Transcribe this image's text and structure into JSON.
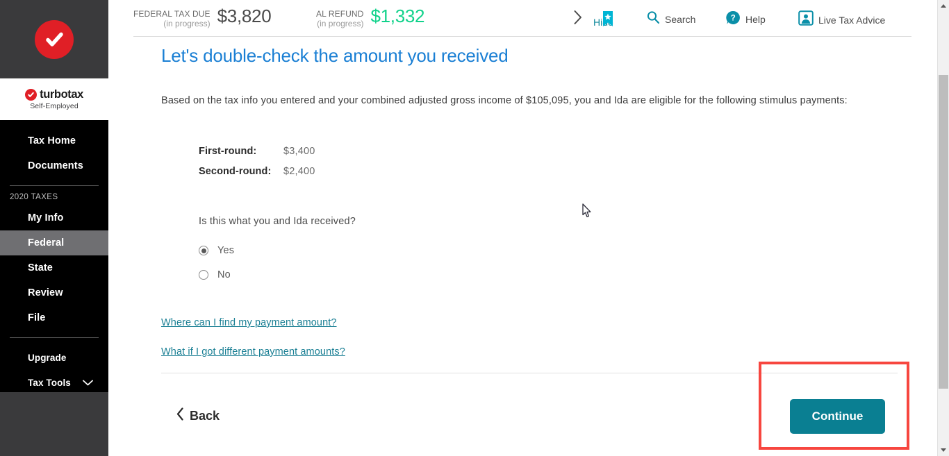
{
  "sidebar": {
    "logo": {
      "brand": "turbotax",
      "edition": "Self-Employed",
      "mark_icon": "red-check-circle-icon"
    },
    "primary_items": [
      {
        "label": "Tax Home",
        "name": "tax-home"
      },
      {
        "label": "Documents",
        "name": "documents"
      }
    ],
    "section_label": "2020 TAXES",
    "tax_items": [
      {
        "label": "My Info",
        "name": "my-info",
        "active": false
      },
      {
        "label": "Federal",
        "name": "federal",
        "active": true
      },
      {
        "label": "State",
        "name": "state",
        "active": false
      },
      {
        "label": "Review",
        "name": "review",
        "active": false
      },
      {
        "label": "File",
        "name": "file",
        "active": false
      }
    ],
    "footer_items": [
      {
        "label": "Upgrade",
        "name": "upgrade",
        "chevron": false
      },
      {
        "label": "Tax Tools",
        "name": "tax-tools",
        "chevron": true
      }
    ]
  },
  "header": {
    "federal": {
      "caption": "FEDERAL TAX DUE",
      "status": "(in progress)",
      "amount": "$3,820",
      "color": "#4a4a4a"
    },
    "state": {
      "caption": "AL REFUND",
      "status": "(in progress)",
      "amount": "$1,332",
      "color": "#11d28b"
    },
    "expand_icon": "chevron-right-icon",
    "hide_label": "Hide",
    "bookmark_icon": "bookmark-star-icon",
    "tools": [
      {
        "label": "Search",
        "icon": "search-icon",
        "name": "search"
      },
      {
        "label": "Help",
        "icon": "help-question-icon",
        "name": "help"
      },
      {
        "label": "Live Tax Advice",
        "icon": "live-advisor-icon",
        "name": "live-tax-advice"
      }
    ]
  },
  "main": {
    "title": "Let's double-check the amount you received",
    "intro": "Based on the tax info you entered and your combined adjusted gross income of $105,095, you and Ida are eligible for the following stimulus payments:",
    "amounts": [
      {
        "label": "First-round:",
        "value": "$3,400"
      },
      {
        "label": "Second-round:",
        "value": "$2,400"
      }
    ],
    "question": "Is this what you and Ida received?",
    "options": [
      {
        "label": "Yes",
        "selected": true
      },
      {
        "label": "No",
        "selected": false
      }
    ],
    "links": [
      {
        "label": "Where can I find my payment amount?"
      },
      {
        "label": "What if I got different payment amounts?"
      }
    ],
    "back_label": "Back",
    "back_icon": "chevron-left-icon",
    "continue_label": "Continue"
  },
  "colors": {
    "accent_teal": "#0a7f92",
    "heading_blue": "#1a7fd4",
    "brand_red": "#e01f26",
    "refund_green": "#11d28b",
    "highlight_red": "#f7463f"
  },
  "scrollbar": {
    "up_icon": "scroll-up-arrow-icon",
    "down_icon": "scroll-down-arrow-icon"
  }
}
